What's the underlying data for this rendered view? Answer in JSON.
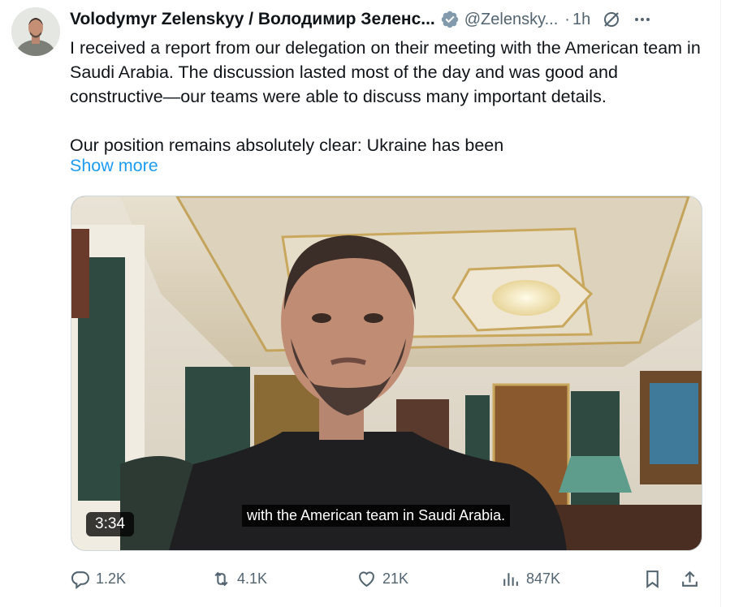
{
  "author": {
    "name": "Volodymyr Zelenskyy / Володимир Зеленс...",
    "handle": "@Zelensky...",
    "dot": "·",
    "time": "1h",
    "avatar_icon": "avatar-photo",
    "verified_icon": "verified-badge-icon"
  },
  "tweet": {
    "paragraph1": "I received a report from our delegation on their meeting with the American team in Saudi Arabia. The discussion lasted most of the day and was good and constructive—our teams were able to discuss many important details.",
    "paragraph2": "Our position remains absolutely clear: Ukraine has been",
    "show_more": "Show more"
  },
  "media": {
    "duration": "3:34",
    "caption": "with the American team in Saudi Arabia."
  },
  "actions": {
    "replies": "1.2K",
    "reposts": "4.1K",
    "likes": "21K",
    "views": "847K"
  },
  "colors": {
    "link": "#1d9bf0",
    "secondary": "#536471",
    "text": "#0f1419"
  }
}
